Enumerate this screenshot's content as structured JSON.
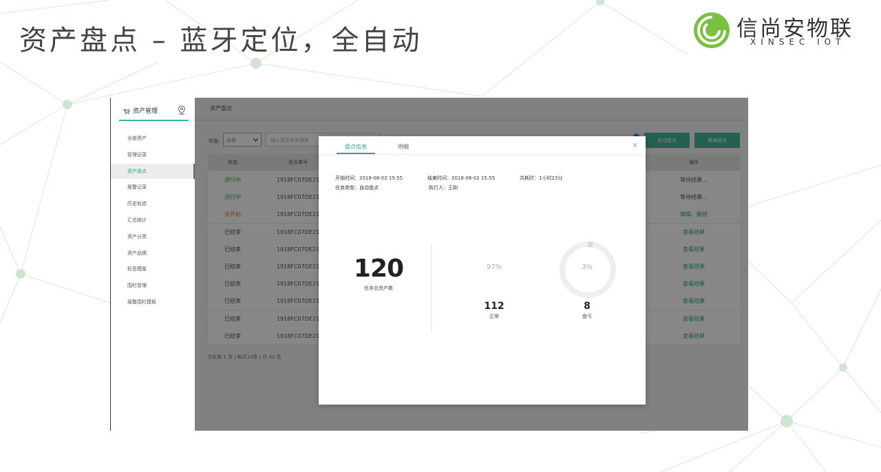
{
  "slide": {
    "title": "资产盘点 – 蓝牙定位，全自动",
    "logo_cn": "信尚安物联",
    "logo_en": "XINSEC IOT",
    "accent_color": "#3cb4a3"
  },
  "sidebar": {
    "title": "资产管理",
    "icons": [
      "cart-icon",
      "location-pin-icon"
    ],
    "items": [
      {
        "label": "全部资产",
        "active": false
      },
      {
        "label": "管理记录",
        "active": false
      },
      {
        "label": "资产盘点",
        "active": true
      },
      {
        "label": "报警记录",
        "active": false
      },
      {
        "label": "历史轨迹",
        "active": false
      },
      {
        "label": "汇总统计",
        "active": false
      },
      {
        "label": "资产分类",
        "active": false
      },
      {
        "label": "资产品牌",
        "active": false
      },
      {
        "label": "标签模版",
        "active": false
      },
      {
        "label": "围栏管理",
        "active": false
      },
      {
        "label": "报警围栏模板",
        "active": false
      }
    ]
  },
  "main": {
    "breadcrumb": "资产盘点",
    "filter_label": "状态:",
    "status_select_value": "全部",
    "search_placeholder": "输入盘点单号搜索",
    "buttons": {
      "auto_inventory": "自动盘点",
      "normal_inventory": "普通盘点"
    },
    "table": {
      "headers": [
        "状态",
        "盘点单号",
        "操作"
      ],
      "rows": [
        {
          "status": "进行中",
          "status_color": "#3aa83a",
          "id": "1918FC07DE21",
          "action": "等待结果...",
          "action_color": "#555555"
        },
        {
          "status": "进行中",
          "status_color": "#3aa83a",
          "id": "1918FC07DE21",
          "action": "等待结果...",
          "action_color": "#555555"
        },
        {
          "status": "未开始",
          "status_color": "#e67e22",
          "id": "1918FC07DE21",
          "action": "编辑、删除",
          "action_color": "#2fa58f"
        },
        {
          "status": "已结束",
          "status_color": "#555555",
          "id": "1918FC07DE21",
          "action": "查看结果",
          "action_color": "#2fa58f"
        },
        {
          "status": "已结束",
          "status_color": "#555555",
          "id": "1918FC07DE21",
          "action": "查看结果",
          "action_color": "#2fa58f"
        },
        {
          "status": "已结束",
          "status_color": "#555555",
          "id": "1918FC07DE21",
          "action": "查看结果",
          "action_color": "#2fa58f"
        },
        {
          "status": "已结束",
          "status_color": "#555555",
          "id": "1918FC07DE21",
          "action": "查看结果",
          "action_color": "#2fa58f"
        },
        {
          "status": "已结束",
          "status_color": "#555555",
          "id": "1918FC07DE21",
          "action": "查看结果",
          "action_color": "#2fa58f"
        },
        {
          "status": "已结束",
          "status_color": "#555555",
          "id": "1918FC07DE21",
          "action": "查看结果",
          "action_color": "#2fa58f"
        },
        {
          "status": "已结束",
          "status_color": "#555555",
          "id": "1918FC07DE21",
          "action": "查看结果",
          "action_color": "#2fa58f"
        }
      ]
    },
    "pager": "当前第 1 页 | 每页10条 | 共 40 条"
  },
  "modal": {
    "tabs": [
      {
        "label": "盘点信息",
        "active": true
      },
      {
        "label": "明细",
        "active": false
      }
    ],
    "close_symbol": "×",
    "start_time": "开始时间：2018-08-02 15:55",
    "end_time": "结束时间：2018-08-02 15:55",
    "duration": "共耗时：1小时23分",
    "task_type": "任务类型：自动盘点",
    "executor": "执行人：王刚",
    "total_count": "120",
    "total_label": "任务总资产数",
    "normal_pct": "97%",
    "normal_count": "112",
    "normal_label": "正常",
    "loss_pct": "3%",
    "loss_count": "8",
    "loss_label": "盘亏",
    "loss_fraction": 0.03
  }
}
